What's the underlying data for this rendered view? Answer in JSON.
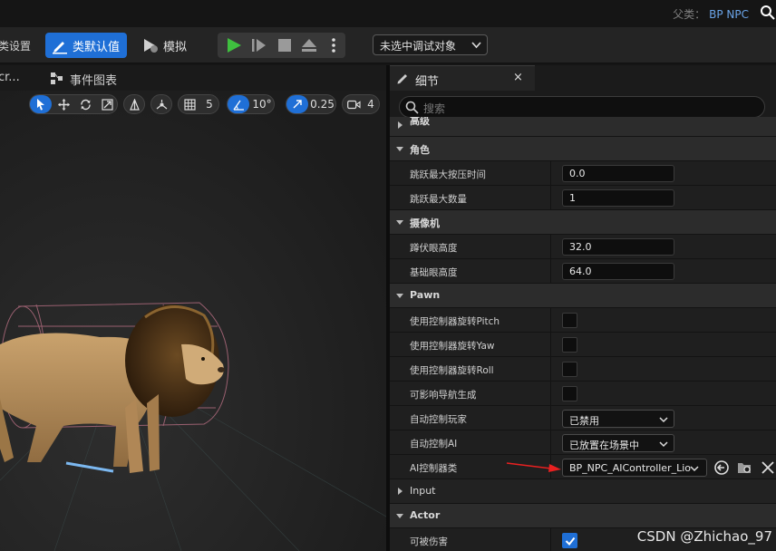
{
  "titlebar": {
    "parent_label": "父类：",
    "parent_value": "BP NPC"
  },
  "toolbar": {
    "class_settings_partial": "类设置",
    "class_defaults_label": "类默认值",
    "simulate_label": "模拟",
    "debug_target": "未选中调试对象"
  },
  "left_tabs": {
    "tab1_partial": "cr...",
    "graph_label": "事件图表"
  },
  "viewport_toolbar": {
    "grid_value": "5",
    "rotation_value": "10°",
    "scale_value": "0.25",
    "camera_speed": "4"
  },
  "details": {
    "tab_label": "细节",
    "close_glyph": "×",
    "search_placeholder": "搜索",
    "cut_category": "高级",
    "categories": {
      "character": "角色",
      "camera": "摄像机",
      "pawn": "Pawn",
      "input": "Input",
      "actor": "Actor"
    },
    "props": {
      "jump_max_hold_time": {
        "label": "跳跃最大按压时间",
        "value": "0.0"
      },
      "jump_max_count": {
        "label": "跳跃最大数量",
        "value": "1"
      },
      "crouched_eye_height": {
        "label": "蹲伏眼高度",
        "value": "32.0"
      },
      "base_eye_height": {
        "label": "基础眼高度",
        "value": "64.0"
      },
      "use_ctrl_pitch": {
        "label": "使用控制器旋转Pitch",
        "checked": false
      },
      "use_ctrl_yaw": {
        "label": "使用控制器旋转Yaw",
        "checked": false
      },
      "use_ctrl_roll": {
        "label": "使用控制器旋转Roll",
        "checked": false
      },
      "affect_nav": {
        "label": "可影响导航生成",
        "checked": false
      },
      "auto_possess_player": {
        "label": "自动控制玩家",
        "value": "已禁用"
      },
      "auto_possess_ai": {
        "label": "自动控制AI",
        "value": "已放置在场景中"
      },
      "ai_controller_class": {
        "label": "AI控制器类",
        "value": "BP_NPC_AIController_Lio"
      },
      "can_be_damaged": {
        "label": "可被伤害",
        "checked": true
      }
    }
  },
  "watermark": "CSDN @Zhichao_97",
  "colors": {
    "accent_blue": "#1f6fd6",
    "annotation_red": "#e82020",
    "link_blue": "#6aa4e8"
  }
}
